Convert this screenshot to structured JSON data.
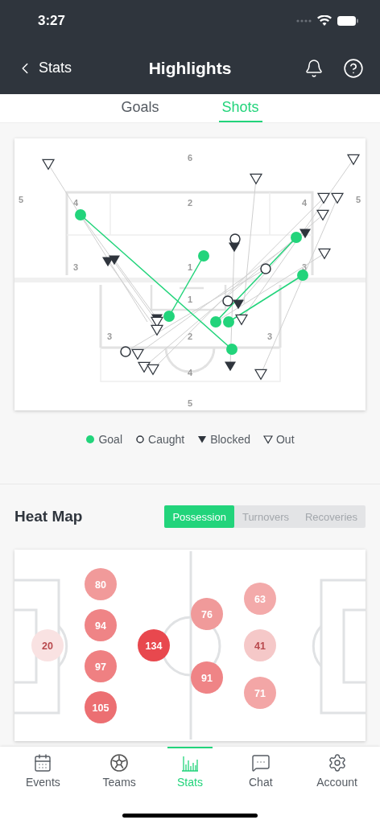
{
  "status_bar": {
    "time": "3:27"
  },
  "nav": {
    "back": "Stats",
    "title": "Highlights"
  },
  "tabs": [
    {
      "label": "Goals",
      "selected": false
    },
    {
      "label": "Shots",
      "selected": true
    }
  ],
  "shot_map": {
    "zone_labels": [
      "6",
      "5",
      "4",
      "2",
      "4",
      "5",
      "3",
      "1",
      "3",
      "1",
      "3",
      "2",
      "3",
      "4",
      "5"
    ],
    "shots": [
      {
        "kind": "goal"
      },
      {
        "kind": "goal"
      },
      {
        "kind": "goal"
      },
      {
        "kind": "goal"
      },
      {
        "kind": "goal"
      },
      {
        "kind": "goal"
      },
      {
        "kind": "goal"
      },
      {
        "kind": "goal"
      },
      {
        "kind": "caught"
      },
      {
        "kind": "caught"
      },
      {
        "kind": "caught"
      },
      {
        "kind": "caught"
      },
      {
        "kind": "blocked"
      },
      {
        "kind": "blocked"
      },
      {
        "kind": "blocked"
      },
      {
        "kind": "blocked"
      },
      {
        "kind": "blocked"
      },
      {
        "kind": "blocked"
      },
      {
        "kind": "blocked"
      },
      {
        "kind": "out"
      },
      {
        "kind": "out"
      },
      {
        "kind": "out"
      },
      {
        "kind": "out"
      },
      {
        "kind": "out"
      },
      {
        "kind": "out"
      },
      {
        "kind": "out"
      },
      {
        "kind": "out"
      },
      {
        "kind": "out"
      },
      {
        "kind": "out"
      },
      {
        "kind": "out"
      },
      {
        "kind": "out"
      },
      {
        "kind": "out"
      },
      {
        "kind": "out"
      }
    ]
  },
  "legend": [
    {
      "kind": "goal",
      "label": "Goal"
    },
    {
      "kind": "caught",
      "label": "Caught"
    },
    {
      "kind": "blocked",
      "label": "Blocked"
    },
    {
      "kind": "out",
      "label": "Out"
    }
  ],
  "heat_map": {
    "title": "Heat Map",
    "segments": [
      {
        "label": "Possession",
        "selected": true
      },
      {
        "label": "Turnovers",
        "selected": false
      },
      {
        "label": "Recoveries",
        "selected": false
      }
    ],
    "bubbles": [
      {
        "value": "80",
        "color": "#f19a9a"
      },
      {
        "value": "94",
        "color": "#ef8486"
      },
      {
        "value": "97",
        "color": "#ef8082"
      },
      {
        "value": "105",
        "color": "#ec6f72"
      },
      {
        "value": "20",
        "color": "#f9e2e2"
      },
      {
        "value": "134",
        "color": "#e8484e"
      },
      {
        "value": "76",
        "color": "#f09a9a"
      },
      {
        "value": "91",
        "color": "#ef8486"
      },
      {
        "value": "63",
        "color": "#f3aaaa"
      },
      {
        "value": "41",
        "color": "#f5c8c8"
      },
      {
        "value": "71",
        "color": "#f3a6a6"
      }
    ]
  },
  "tab_bar": [
    {
      "label": "Events",
      "selected": false
    },
    {
      "label": "Teams",
      "selected": false
    },
    {
      "label": "Stats",
      "selected": true
    },
    {
      "label": "Chat",
      "selected": false
    },
    {
      "label": "Account",
      "selected": false
    }
  ]
}
